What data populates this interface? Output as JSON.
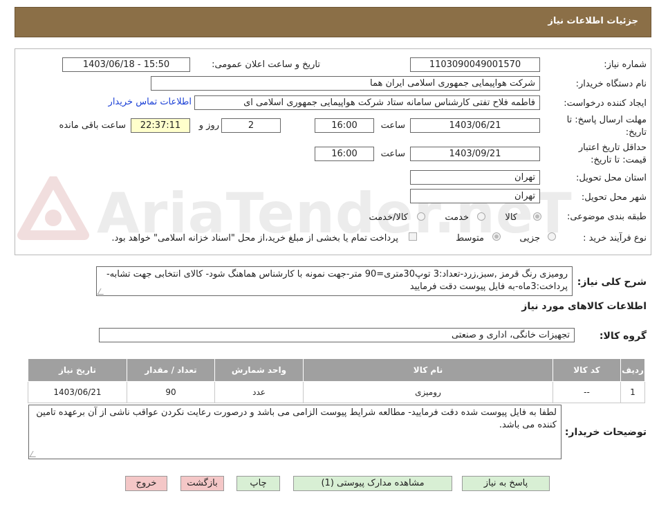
{
  "header": {
    "title": "جزئیات اطلاعات نیاز"
  },
  "watermark": {
    "text": "AriaTender.neT",
    "logo": "ariatender-logo"
  },
  "form": {
    "need_number": {
      "label": "شماره نیاز:",
      "value": "1103090049001570"
    },
    "announce_datetime": {
      "label": "تاریخ و ساعت اعلان عمومی:",
      "value": "1403/06/18 - 15:50"
    },
    "buyer_org": {
      "label": "نام دستگاه خریدار:",
      "value": "شرکت هواپیمایی جمهوری اسلامی ایران هما"
    },
    "creator": {
      "label": "ایجاد کننده درخواست:",
      "value": "فاطمه فلاح تفتی کارشناس سامانه ستاد شرکت هواپیمایی جمهوری اسلامی ای",
      "contact_link": "اطلاعات تماس خریدار"
    },
    "reply_deadline": {
      "label_line1": "مهلت ارسال پاسخ: تا",
      "label_line2": "تاریخ:",
      "date": "1403/06/21",
      "time_label": "ساعت",
      "time": "16:00",
      "days": "2",
      "days_label": "روز و",
      "remaining": "22:37:11",
      "remaining_label": "ساعت باقی مانده"
    },
    "price_validity": {
      "label_line1": "حداقل تاریخ اعتبار",
      "label_line2": "قیمت: تا تاریخ:",
      "date": "1403/09/21",
      "time_label": "ساعت",
      "time": "16:00"
    },
    "delivery_province": {
      "label": "استان محل تحویل:",
      "value": "تهران"
    },
    "delivery_city": {
      "label": "شهر محل تحویل:",
      "value": "تهران"
    },
    "category": {
      "label": "طبقه بندی موضوعی:",
      "options": [
        "کالا",
        "خدمت",
        "کالا/خدمت"
      ],
      "selected": "کالا"
    },
    "purchase_type": {
      "label": "نوع فرآیند خرید :",
      "options": [
        "جزیی",
        "متوسط"
      ],
      "selected": "متوسط",
      "treasury_note": "پرداخت تمام یا بخشی از مبلغ خرید،از محل \"اسناد خزانه اسلامی\" خواهد بود."
    }
  },
  "summary": {
    "label": "شرح کلی نیاز:",
    "text": "رومیزی رنگ قرمز ,سبز,زرد-تعداد:3 توپ30متری=90 متر-جهت نمونه با کارشناس هماهنگ شود- کالای انتخابی جهت تشابه-پرداخت:3ماه-به فایل پیوست دقت فرمایید"
  },
  "goods_info": {
    "title": "اطلاعات کالاهای مورد نیاز",
    "group_label": "گروه کالا:",
    "group_value": "تجهیزات خانگی، اداری و صنعتی"
  },
  "table": {
    "headers": [
      "ردیف",
      "کد کالا",
      "نام کالا",
      "واحد شمارش",
      "تعداد / مقدار",
      "تاریخ نیاز"
    ],
    "rows": [
      [
        "1",
        "--",
        "رومیزی",
        "عدد",
        "90",
        "1403/06/21"
      ]
    ]
  },
  "buyer_notes": {
    "label": "توضیحات خریدار:",
    "text": "لطفا به فایل پیوست شده دقت فرمایید- مطالعه شرایط پیوست الزامی می باشد و درصورت رعایت نکردن عواقب ناشی از آن برعهده تامین کننده می باشد."
  },
  "buttons": {
    "reply": "پاسخ به نیاز",
    "attachments": "مشاهده مدارک پیوستی (1)",
    "print": "چاپ",
    "back": "بازگشت",
    "exit": "خروج"
  },
  "colors": {
    "header_bg": "#8b6f47",
    "table_header_bg": "#a0a0a0",
    "green_button": "#d8efd4",
    "red_button": "#f4c7c7",
    "highlight": "#ffffcc"
  }
}
